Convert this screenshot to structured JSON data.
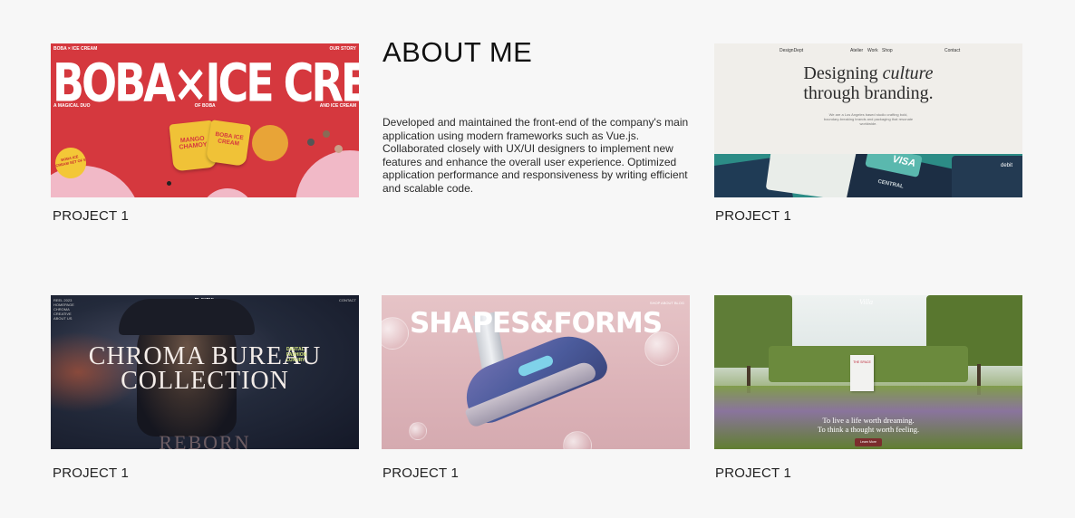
{
  "about": {
    "title": "ABOUT ME",
    "body": "Developed and maintained the front-end of the company's main application using modern frameworks such as Vue.js. Collaborated closely with UX/UI designers to implement new features and enhance the overall user experience. Optimized application performance and responsiveness by writing efficient and scalable code."
  },
  "projects": [
    {
      "caption": "PROJECT 1",
      "thumb": {
        "top_left": "BOBA × ICE CREAM",
        "top_right": "OUR STORY",
        "headline": "BOBA×ICE CREAM",
        "sub_left": "A MAGICAL DUO",
        "sub_center": "OF BOBA",
        "sub_right": "AND ICE CREAM",
        "cup_label": "MANGO CHAMOY",
        "cup_label_2": "BOBA ICE CREAM",
        "badge": "BOBA ICE CREAM SET OF 6"
      }
    },
    {
      "caption": "PROJECT 1",
      "thumb": {
        "nav_logo": "DesignDept",
        "nav_items": [
          "Atelier",
          "Work",
          "Shop"
        ],
        "nav_contact": "Contact",
        "hero_line1_a": "Designing ",
        "hero_line1_b": "culture",
        "hero_line2": "through branding.",
        "small": "We are a Los Angeles based studio crafting bold, boundary-breaking brands and packaging that resonate worldwide.",
        "card_text": "VISA",
        "card_debit": "debit",
        "card_debit_2": "debit",
        "card_bank": "CENTRAL"
      }
    },
    {
      "caption": "PROJECT 1",
      "thumb": {
        "menu": [
          "REEL 2023",
          "HOMEPAGE",
          "CHROMA",
          "CREATIVE",
          "ABOUT US"
        ],
        "brand": "PLAYFUL",
        "contact": "CONTACT",
        "title_1": "CHROMA BUREAU",
        "title_2": "COLLECTION",
        "tag": "DIGITAL FASHION LUXURY",
        "bottom": "REBORN"
      }
    },
    {
      "caption": "PROJECT 1",
      "thumb": {
        "title": "SHAPES&FORMS",
        "nav": "SHOP   ABOUT   BLOG"
      }
    },
    {
      "caption": "PROJECT 1",
      "thumb": {
        "logo": "Villa",
        "sign": "THE SPACE",
        "quote_1": "To live a life worth dreaming.",
        "quote_2": "To think a thought worth feeling.",
        "button": "Learn More"
      }
    }
  ],
  "colors": {
    "background": "#f7f7f7",
    "boba_red": "#d5383e",
    "boba_pink": "#f1b9c7",
    "teal": "#2c8c86",
    "chroma_tag": "#d4e57a"
  }
}
